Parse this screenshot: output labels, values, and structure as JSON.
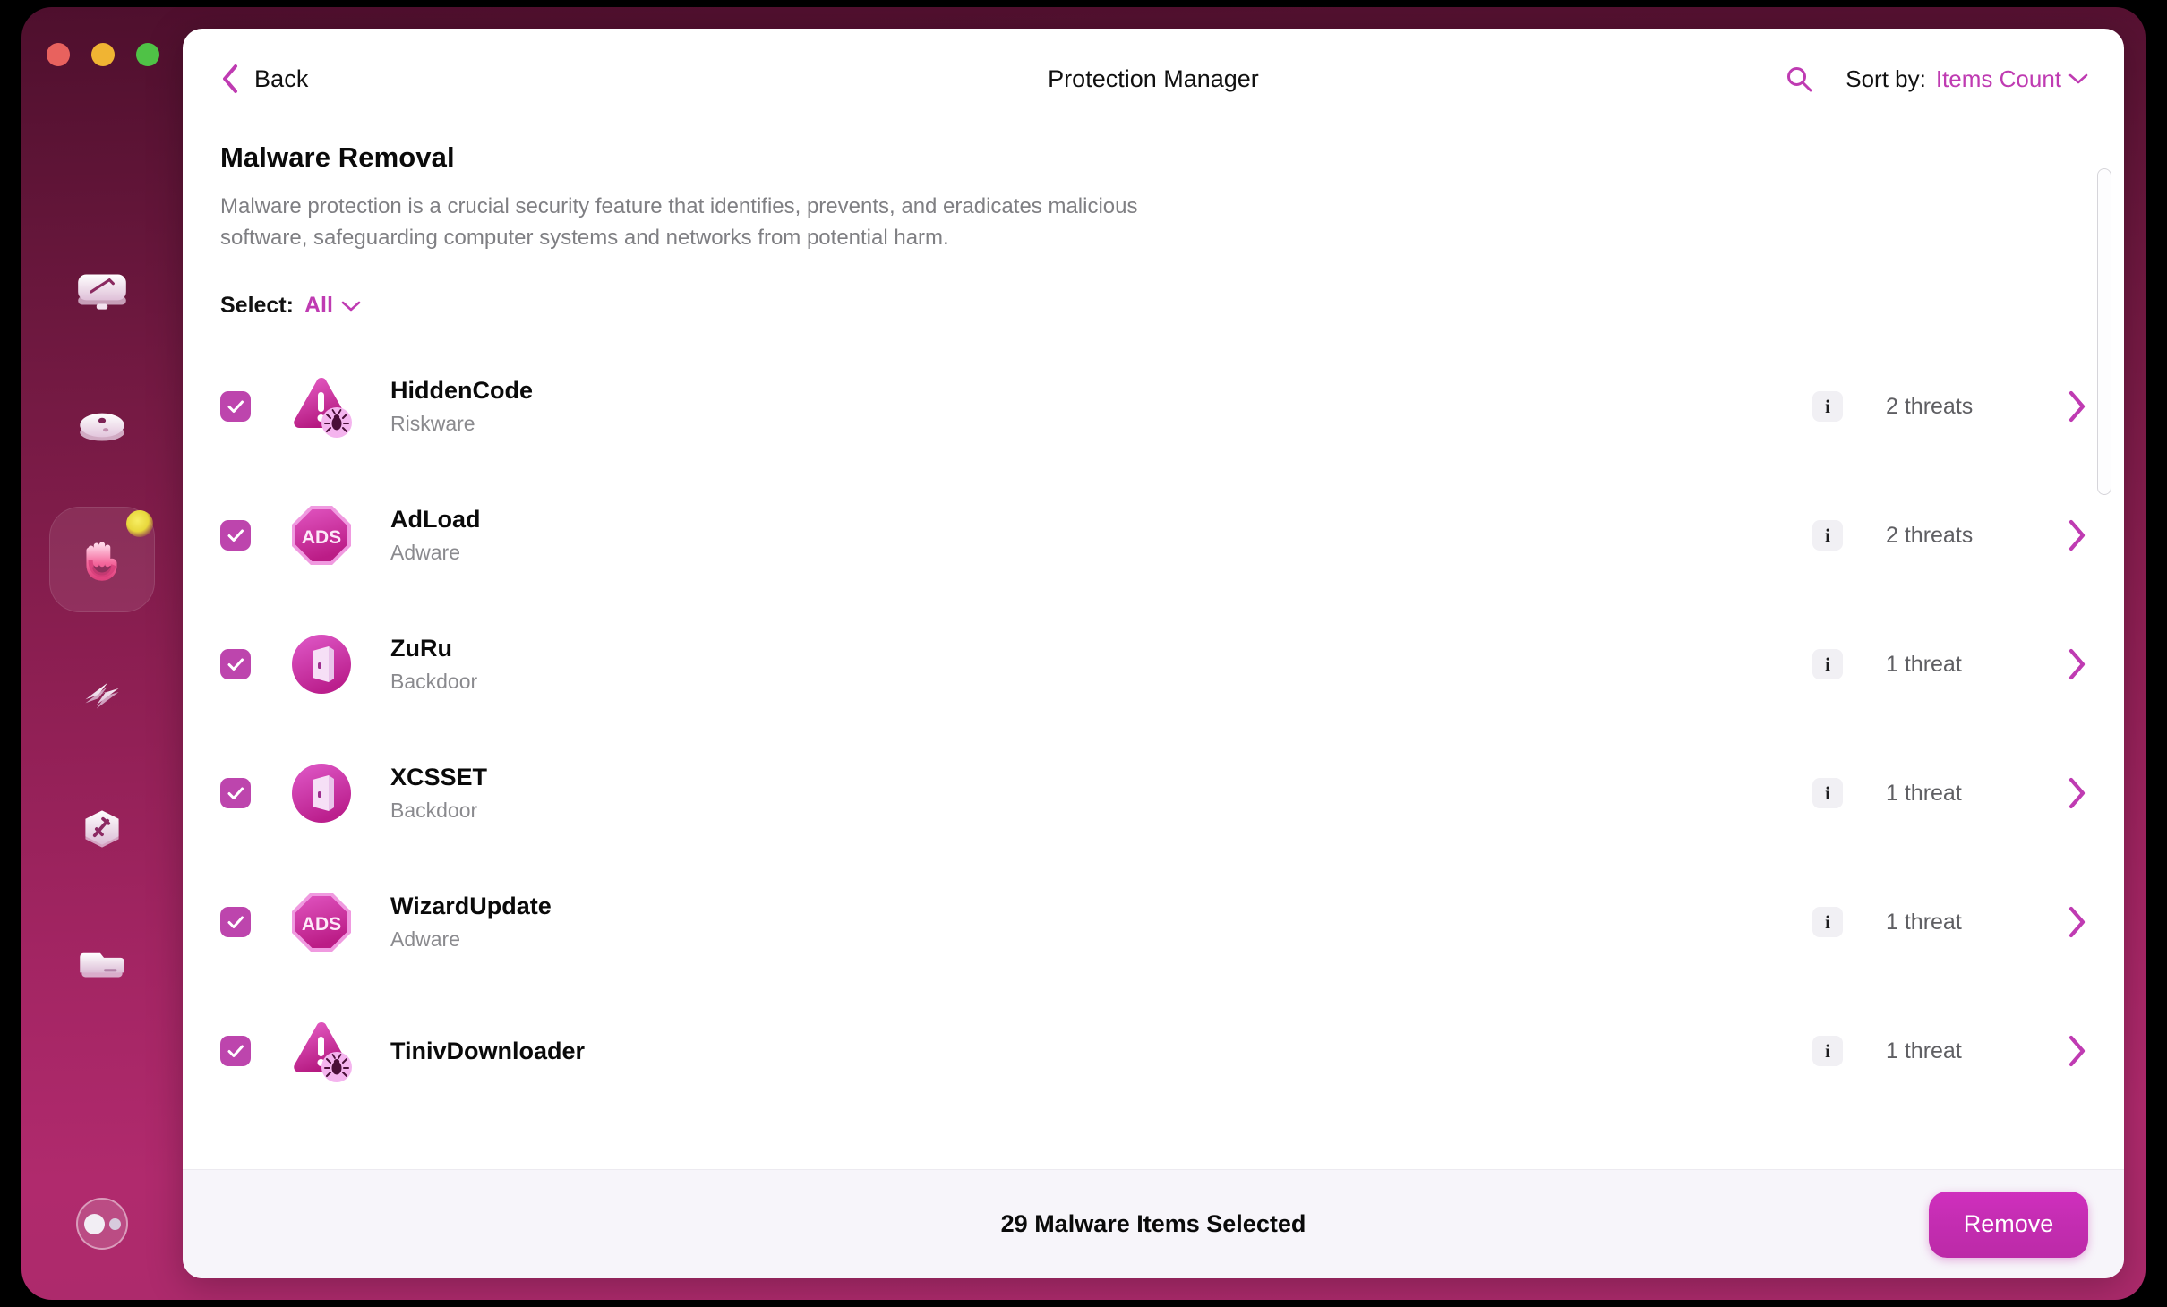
{
  "window": {
    "traffic_lights": [
      {
        "name": "close",
        "color": "#e8625e"
      },
      {
        "name": "minimize",
        "color": "#f0b433"
      },
      {
        "name": "zoom",
        "color": "#4fc246"
      }
    ]
  },
  "sidebar": {
    "items": [
      {
        "icon": "smart-scan-icon",
        "active": false,
        "badge": false
      },
      {
        "icon": "cleanup-icon",
        "active": false,
        "badge": false
      },
      {
        "icon": "protection-hand-icon",
        "active": true,
        "badge": true
      },
      {
        "icon": "speed-lightning-icon",
        "active": false,
        "badge": false
      },
      {
        "icon": "applications-hexagon-icon",
        "active": false,
        "badge": false
      },
      {
        "icon": "my-clutter-folder-icon",
        "active": false,
        "badge": false
      }
    ],
    "avatar": {
      "icon": "account-avatar-icon"
    }
  },
  "header": {
    "back_label": "Back",
    "title": "Protection Manager",
    "search_icon": "search-icon",
    "sort_label": "Sort by:",
    "sort_value": "Items Count",
    "sort_chevron": "chevron-down-icon"
  },
  "main": {
    "section_title": "Malware Removal",
    "section_desc": "Malware protection is a crucial security feature that identifies, prevents, and eradicates malicious software, safeguarding computer systems and networks from potential harm.",
    "select_label": "Select:",
    "select_value": "All",
    "select_chevron": "chevron-down-icon",
    "info_glyph": "i"
  },
  "malware_items": [
    {
      "name": "HiddenCode",
      "type": "Riskware",
      "icon": "warning-triangle-bug-icon",
      "threats": "2 threats",
      "checked": true
    },
    {
      "name": "AdLoad",
      "type": "Adware",
      "icon": "ads-octagon-icon",
      "threats": "2 threats",
      "checked": true
    },
    {
      "name": "ZuRu",
      "type": "Backdoor",
      "icon": "backdoor-door-icon",
      "threats": "1 threat",
      "checked": true
    },
    {
      "name": "XCSSET",
      "type": "Backdoor",
      "icon": "backdoor-door-icon",
      "threats": "1 threat",
      "checked": true
    },
    {
      "name": "WizardUpdate",
      "type": "Adware",
      "icon": "ads-octagon-icon",
      "threats": "1 threat",
      "checked": true
    },
    {
      "name": "TinivDownloader",
      "type": "",
      "icon": "warning-triangle-bug-icon",
      "threats": "1 threat",
      "checked": true
    }
  ],
  "footer": {
    "status": "29 Malware Items Selected",
    "remove_label": "Remove"
  },
  "colors": {
    "accent": "#bf3bb2",
    "checkbox": "#bd45ad",
    "remove_button": "#c42db2",
    "sidebar_top": "#4e0f2d",
    "sidebar_bottom": "#b02a6d"
  }
}
